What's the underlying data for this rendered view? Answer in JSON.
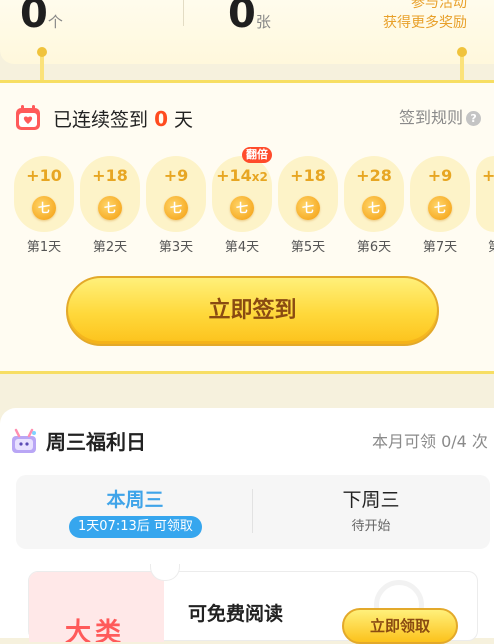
{
  "stats": {
    "left_value": "0",
    "left_unit": "个",
    "right_value": "0",
    "right_unit": "张"
  },
  "promo": {
    "line1": "参与活动",
    "line2": "获得更多奖励"
  },
  "checkin": {
    "streak_prefix": "已连续签到",
    "streak_count": "0",
    "streak_suffix": "天",
    "rules_label": "签到规则",
    "rules_icon": "?",
    "double_badge": "翻倍",
    "coin_glyph": "七",
    "days": [
      {
        "amount": "+10",
        "multiplier": "",
        "label": "第1天"
      },
      {
        "amount": "+18",
        "multiplier": "",
        "label": "第2天"
      },
      {
        "amount": "+9",
        "multiplier": "",
        "label": "第3天"
      },
      {
        "amount": "+14",
        "multiplier": "x2",
        "label": "第4天"
      },
      {
        "amount": "+18",
        "multiplier": "",
        "label": "第5天"
      },
      {
        "amount": "+28",
        "multiplier": "",
        "label": "第6天"
      },
      {
        "amount": "+9",
        "multiplier": "",
        "label": "第7天"
      },
      {
        "amount": "+",
        "multiplier": "",
        "label": "第"
      }
    ],
    "sign_button": "立即签到"
  },
  "wednesday": {
    "title": "周三福利日",
    "monthly_count": "本月可领 0/4 次",
    "tabs": [
      {
        "title": "本周三",
        "status": "1天07:13后 可领取"
      },
      {
        "title": "下周三",
        "status": "待开始"
      }
    ],
    "offer": {
      "thumb_text": "大类",
      "title": "可免费阅读",
      "button": "立即领取"
    }
  },
  "colors": {
    "accent_orange": "#ff4b1f",
    "coin_gold": "#f7ad28",
    "button_yellow": "#ffd83a",
    "tab_blue": "#36a6ee"
  }
}
